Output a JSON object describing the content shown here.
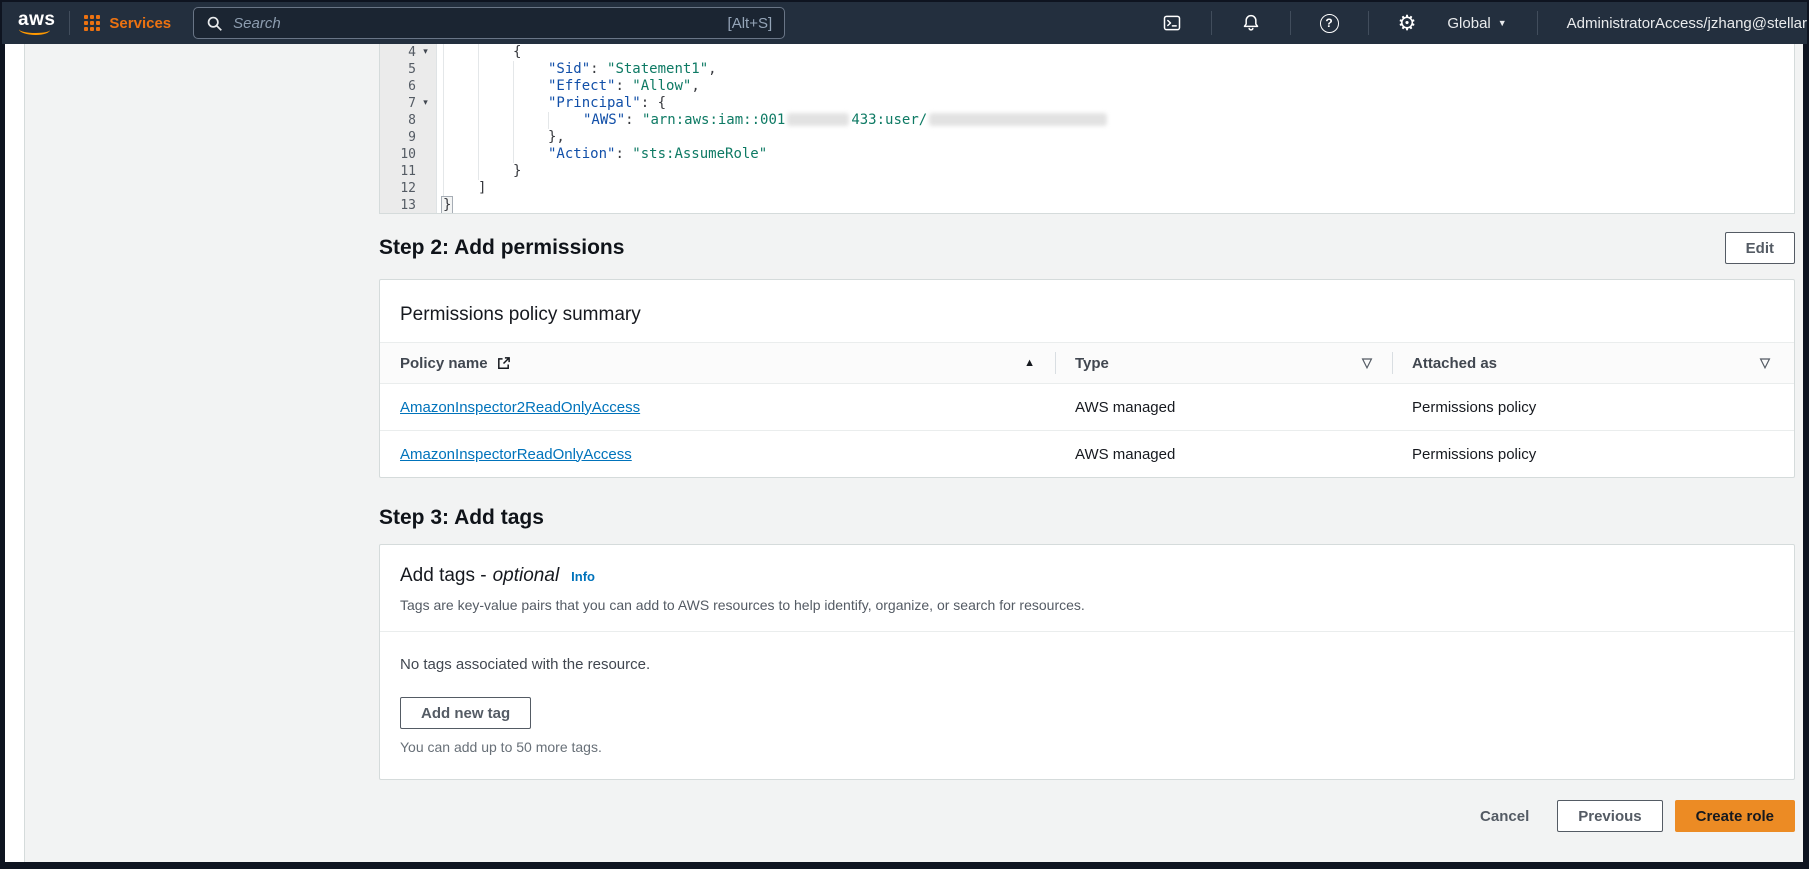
{
  "topnav": {
    "logo": "aws",
    "services_label": "Services",
    "search_placeholder": "Search",
    "search_shortcut": "[Alt+S]",
    "region_label": "Global",
    "account_label": "AdministratorAccess/jzhang@stellar"
  },
  "editor": {
    "lines": [
      {
        "num": "4",
        "fold": true,
        "indent": 8,
        "segs": [
          {
            "t": "{",
            "c": "punct"
          }
        ]
      },
      {
        "num": "5",
        "fold": false,
        "indent": 12,
        "segs": [
          {
            "t": "\"Sid\"",
            "c": "key"
          },
          {
            "t": ": ",
            "c": "punct"
          },
          {
            "t": "\"Statement1\"",
            "c": "str"
          },
          {
            "t": ",",
            "c": "punct"
          }
        ]
      },
      {
        "num": "6",
        "fold": false,
        "indent": 12,
        "segs": [
          {
            "t": "\"Effect\"",
            "c": "key"
          },
          {
            "t": ": ",
            "c": "punct"
          },
          {
            "t": "\"Allow\"",
            "c": "str"
          },
          {
            "t": ",",
            "c": "punct"
          }
        ]
      },
      {
        "num": "7",
        "fold": true,
        "indent": 12,
        "segs": [
          {
            "t": "\"Principal\"",
            "c": "key"
          },
          {
            "t": ": {",
            "c": "punct"
          }
        ]
      },
      {
        "num": "8",
        "fold": false,
        "indent": 16,
        "segs": [
          {
            "t": "\"AWS\"",
            "c": "key"
          },
          {
            "t": ": ",
            "c": "punct"
          },
          {
            "t": "\"arn:aws:iam::001",
            "c": "str"
          },
          {
            "t": "",
            "c": "redact",
            "w": 62
          },
          {
            "t": "433:user/",
            "c": "str"
          },
          {
            "t": "",
            "c": "redact",
            "w": 178
          }
        ]
      },
      {
        "num": "9",
        "fold": false,
        "indent": 12,
        "segs": [
          {
            "t": "},",
            "c": "punct"
          }
        ]
      },
      {
        "num": "10",
        "fold": false,
        "indent": 12,
        "segs": [
          {
            "t": "\"Action\"",
            "c": "key"
          },
          {
            "t": ": ",
            "c": "punct"
          },
          {
            "t": "\"sts:AssumeRole\"",
            "c": "str"
          }
        ]
      },
      {
        "num": "11",
        "fold": false,
        "indent": 8,
        "segs": [
          {
            "t": "}",
            "c": "punct"
          }
        ]
      },
      {
        "num": "12",
        "fold": false,
        "indent": 4,
        "segs": [
          {
            "t": "]",
            "c": "punct"
          }
        ]
      },
      {
        "num": "13",
        "fold": false,
        "indent": 0,
        "segs": [
          {
            "t": "}",
            "c": "match"
          }
        ]
      }
    ]
  },
  "step2": {
    "title": "Step 2: Add permissions",
    "edit_label": "Edit"
  },
  "permissions_card": {
    "title": "Permissions policy summary",
    "table": {
      "columns": [
        "Policy name",
        "Type",
        "Attached as"
      ],
      "rows": [
        {
          "policy_name": "AmazonInspector2ReadOnlyAccess",
          "type": "AWS managed",
          "attached_as": "Permissions policy"
        },
        {
          "policy_name": "AmazonInspectorReadOnlyAccess",
          "type": "AWS managed",
          "attached_as": "Permissions policy"
        }
      ]
    }
  },
  "step3": {
    "title": "Step 3: Add tags"
  },
  "tags_card": {
    "title_main": "Add tags -",
    "title_optional": "optional",
    "info_label": "Info",
    "description": "Tags are key-value pairs that you can add to AWS resources to help identify, organize, or search for resources.",
    "empty_message": "No tags associated with the resource.",
    "add_button_label": "Add new tag",
    "limit_caption": "You can add up to 50 more tags."
  },
  "footer": {
    "cancel_label": "Cancel",
    "previous_label": "Previous",
    "create_label": "Create role"
  },
  "colors": {
    "header_bg": "#232f3e",
    "accent_orange": "#ec7211",
    "primary_button": "#ec8b24",
    "link_blue": "#0073bb",
    "page_bg": "#f2f3f3",
    "code_key": "#114fa8",
    "code_string": "#0e7a64"
  }
}
